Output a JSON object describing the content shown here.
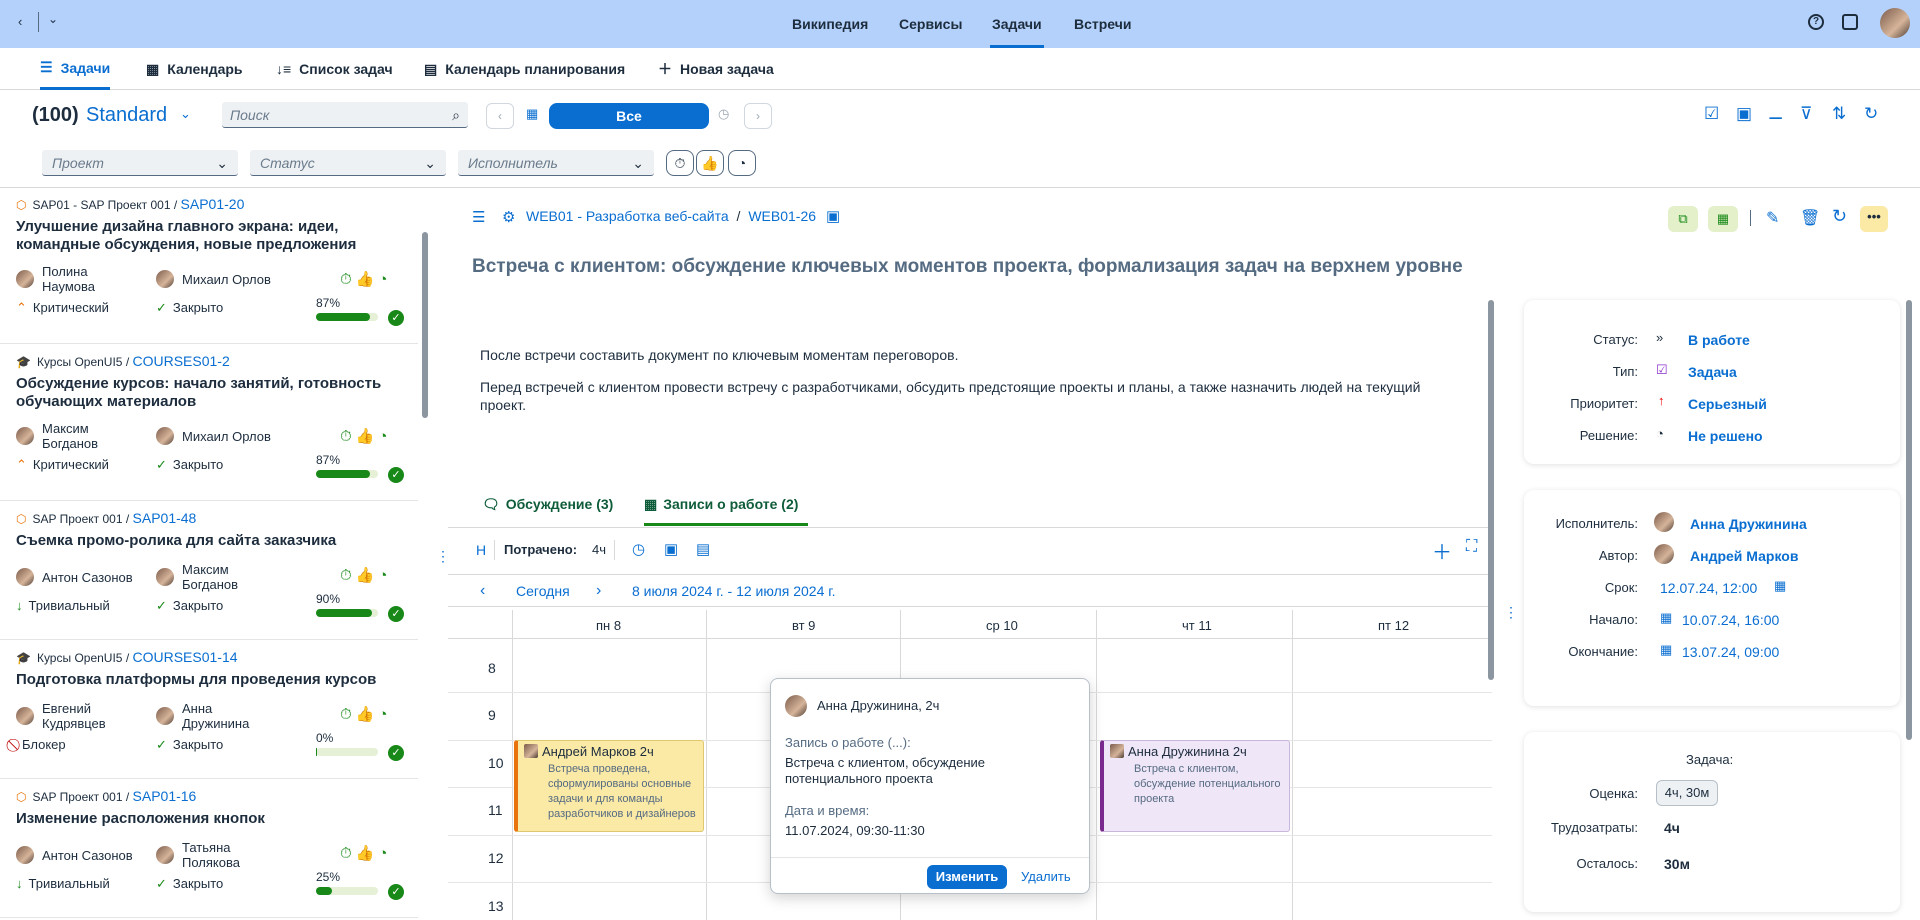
{
  "shell": {
    "nav": [
      "Википедия",
      "Сервисы",
      "Задачи",
      "Встречи"
    ],
    "active": "Задачи"
  },
  "tabs": [
    {
      "icon": "list-icon",
      "label": "Задачи"
    },
    {
      "icon": "calendar-icon",
      "label": "Календарь"
    },
    {
      "icon": "sort-icon",
      "label": "Список задач"
    },
    {
      "icon": "planning-calendar-icon",
      "label": "Календарь планирования"
    },
    {
      "icon": "plus-icon",
      "label": "Новая задача"
    }
  ],
  "filter": {
    "count": "(100)",
    "variant": "Standard",
    "search_placeholder": "Поиск",
    "all_label": "Все",
    "project": "Проект",
    "status": "Статус",
    "assignee": "Исполнитель"
  },
  "cards": [
    {
      "project": "SAP01 - SAP Проект 001",
      "id": "SAP01-20",
      "title": "Улучшение дизайна главного экрана: идеи, командные обсуждения, новые предложения",
      "p1": "Полина\nНаумова",
      "p2": "Михаил Орлов",
      "priority": "Критический",
      "status": "Закрыто",
      "pct": "87%",
      "progress": 0.87,
      "prio_icon": "^^",
      "stat_icon": "✓"
    },
    {
      "project": "Курсы OpenUI5",
      "id": "COURSES01-2",
      "title": "Обсуждение курсов: начало занятий, готовность обучающих материалов",
      "p1": "Максим\nБогданов",
      "p2": "Михаил Орлов",
      "priority": "Критический",
      "status": "Закрыто",
      "pct": "87%",
      "progress": 0.87,
      "prio_icon": "^^",
      "stat_icon": "✓"
    },
    {
      "project": "SAP Проект 001",
      "id": "SAP01-48",
      "title": "Съемка промо-ролика для сайта заказчика",
      "p1": "Антон Сазонов",
      "p2": "Максим\nБогданов",
      "priority": "Тривиальный",
      "status": "Закрыто",
      "pct": "90%",
      "progress": 0.9,
      "prio_icon": "↓",
      "stat_icon": "✓"
    },
    {
      "project": "Курсы OpenUI5",
      "id": "COURSES01-14",
      "title": "Подготовка платформы для проведения курсов",
      "p1": "Евгений\nКудрявцев",
      "p2": "Анна\nДружинина",
      "priority": "Блокер",
      "status": "Закрыто",
      "pct": "0%",
      "progress": 0.02,
      "prio_icon": "⃠",
      "stat_icon": "✓"
    },
    {
      "project": "SAP Проект 001",
      "id": "SAP01-16",
      "title": "Изменение расположения кнопок",
      "p1": "Антон Сазонов",
      "p2": "Татьяна\nПолякова",
      "priority": "Тривиальный",
      "status": "Закрыто",
      "pct": "25%",
      "progress": 0.25,
      "prio_icon": "↓",
      "stat_icon": "✓"
    }
  ],
  "detail": {
    "breadcrumb_project": "WEB01 - Разработка веб-сайта",
    "breadcrumb_sep": "/",
    "breadcrumb_id": "WEB01-26",
    "title": "Встреча с клиентом: обсуждение ключевых моментов проекта, формализация задач на верхнем уровне",
    "desc1": "После встречи составить документ по ключевым моментам переговоров.",
    "desc2": "Перед встречей с клиентом провести встречу с разработчиками, обсудить предстоящие проекты и планы, а также назначить людей на текущий проект.",
    "tab_discussion": "Обсуждение (3)",
    "tab_worklog": "Записи о работе (2)"
  },
  "worklog": {
    "h": "Н",
    "spent_label": "Потрачено:",
    "spent": "4ч",
    "today": "Сегодня",
    "range": "8 июля 2024 г. - 12 июля 2024 г.",
    "days": [
      "пн 8",
      "вт 9",
      "ср 10",
      "чт 11",
      "пт 12"
    ],
    "hours": [
      "8",
      "9",
      "10",
      "11",
      "12",
      "13"
    ]
  },
  "events": [
    {
      "who": "Андрей Марков 2ч",
      "text": "Встреча проведена, сформулированы основные задачи и для команды разработчиков и дизайнеров"
    },
    {
      "who": "Анна Дружинина 2ч",
      "text": "Встреча с клиентом, обсуждение потенциального проекта"
    }
  ],
  "popover": {
    "who": "Анна Дружинина, 2ч",
    "label1": "Запись о работе (...):",
    "text1": "Встреча с клиентом, обсуждение потенциального проекта",
    "label2": "Дата и время:",
    "text2": "11.07.2024, 09:30-11:30",
    "edit": "Изменить",
    "delete": "Удалить"
  },
  "props": {
    "status_l": "Статус:",
    "status": "В работе",
    "type_l": "Тип:",
    "type": "Задача",
    "prio_l": "Приоритет:",
    "prio": "Серьезный",
    "res_l": "Решение:",
    "res": "Не решено"
  },
  "people": {
    "assignee_l": "Исполнитель:",
    "assignee": "Анна Дружинина",
    "author_l": "Автор:",
    "author": "Андрей Марков",
    "due_l": "Срок:",
    "due": "12.07.24, 12:00",
    "start_l": "Начало:",
    "start": "10.07.24, 16:00",
    "end_l": "Окончание:",
    "end": "13.07.24, 09:00"
  },
  "effort": {
    "header": "Задача:",
    "est_l": "Оценка:",
    "est": "4ч, 30м",
    "spent_l": "Трудозатраты:",
    "spent": "4ч",
    "left_l": "Осталось:",
    "left": "30м"
  }
}
